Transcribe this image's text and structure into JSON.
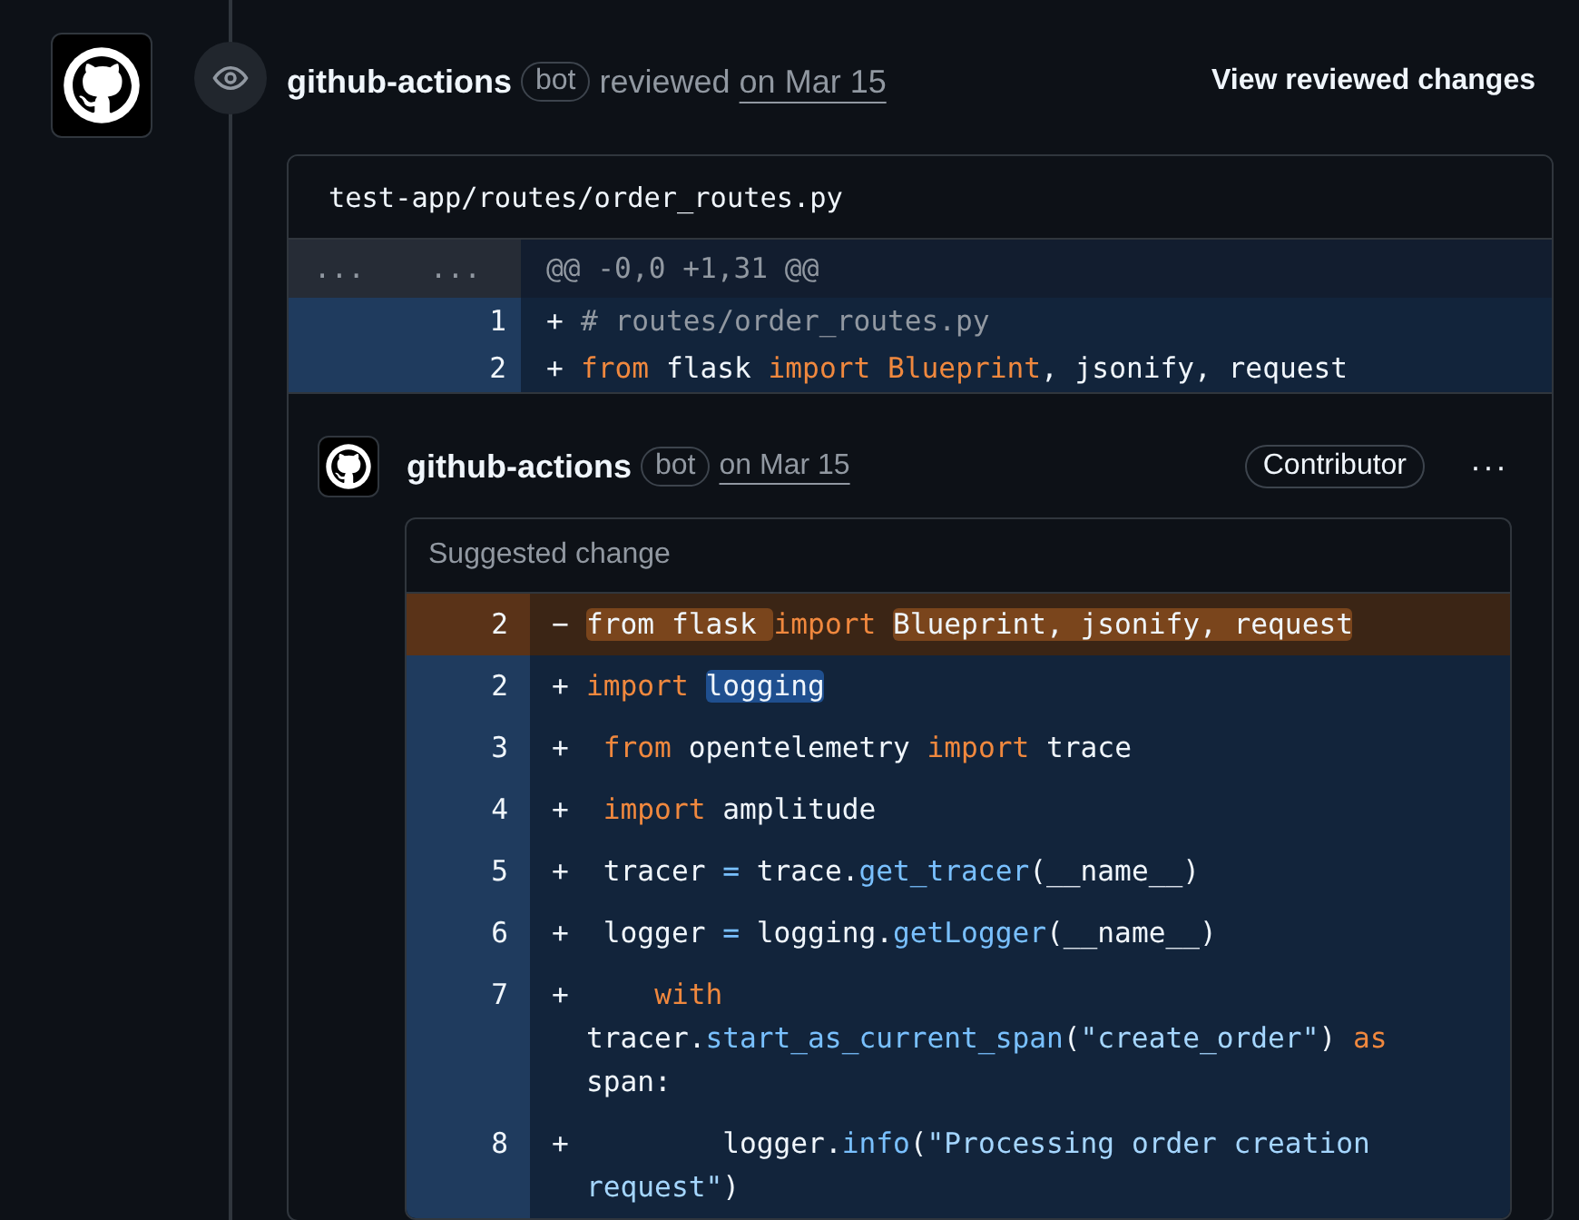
{
  "review": {
    "author": "github-actions",
    "badge": "bot",
    "action": "reviewed",
    "date": "on Mar 15",
    "link": "View reviewed changes"
  },
  "diff": {
    "file": "test-app/routes/order_routes.py",
    "hunk": {
      "old": "...",
      "new": "...",
      "header": "@@ -0,0 +1,31 @@"
    },
    "lines": [
      {
        "kind": "add",
        "new": "1",
        "sign": "+",
        "tokens": [
          {
            "t": "# routes/order_routes.py",
            "kind": "comment"
          }
        ]
      },
      {
        "kind": "add",
        "new": "2",
        "sign": "+",
        "tokens": [
          {
            "t": "from",
            "kind": "keyword"
          },
          {
            "t": " flask ",
            "kind": "text"
          },
          {
            "t": "import",
            "kind": "keyword"
          },
          {
            "t": " Blueprint",
            "kind": "keyword"
          },
          {
            "t": ", jsonify, request",
            "kind": "text"
          }
        ]
      }
    ]
  },
  "comment": {
    "author": "github-actions",
    "badge": "bot",
    "date": "on Mar 15",
    "role": "Contributor",
    "menu": "···",
    "suggestion": {
      "title": "Suggested change",
      "lines": [
        {
          "kind": "del",
          "num": "2",
          "sign": "−",
          "tokens": [
            {
              "t": "from flask ",
              "kind": "text",
              "marked": true
            },
            {
              "t": "import ",
              "kind": "keyword",
              "marked": false
            },
            {
              "t": "Blueprint, jsonify, request",
              "kind": "text",
              "marked": true
            }
          ]
        },
        {
          "kind": "add",
          "num": "2",
          "sign": "+",
          "tokens": [
            {
              "t": "import ",
              "kind": "keyword",
              "marked": false
            },
            {
              "t": "logging",
              "kind": "text",
              "marked": true
            }
          ]
        },
        {
          "kind": "add",
          "num": "3",
          "sign": "+",
          "tokens": [
            {
              "t": " from",
              "kind": "keyword",
              "marked": false
            },
            {
              "t": " opentelemetry ",
              "kind": "text",
              "marked": false
            },
            {
              "t": "import",
              "kind": "keyword",
              "marked": false
            },
            {
              "t": " trace",
              "kind": "text",
              "marked": false
            }
          ]
        },
        {
          "kind": "add",
          "num": "4",
          "sign": "+",
          "tokens": [
            {
              "t": " import",
              "kind": "keyword",
              "marked": false
            },
            {
              "t": " amplitude",
              "kind": "text",
              "marked": false
            }
          ]
        },
        {
          "kind": "add",
          "num": "5",
          "sign": "+",
          "tokens": [
            {
              "t": " tracer ",
              "kind": "text",
              "marked": false
            },
            {
              "t": "=",
              "kind": "operator",
              "marked": false
            },
            {
              "t": " trace.",
              "kind": "text",
              "marked": false
            },
            {
              "t": "get_tracer",
              "kind": "function",
              "marked": false
            },
            {
              "t": "(__name__)",
              "kind": "text",
              "marked": false
            }
          ]
        },
        {
          "kind": "add",
          "num": "6",
          "sign": "+",
          "tokens": [
            {
              "t": " logger ",
              "kind": "text",
              "marked": false
            },
            {
              "t": "=",
              "kind": "operator",
              "marked": false
            },
            {
              "t": " logging.",
              "kind": "text",
              "marked": false
            },
            {
              "t": "getLogger",
              "kind": "function",
              "marked": false
            },
            {
              "t": "(__name__)",
              "kind": "text",
              "marked": false
            }
          ]
        },
        {
          "kind": "add",
          "num": "7",
          "sign": "+",
          "tokens": [
            {
              "t": "    with",
              "kind": "keyword",
              "marked": false
            },
            {
              "t": " tracer.",
              "kind": "text",
              "marked": false
            },
            {
              "t": "start_as_current_span",
              "kind": "function",
              "marked": false
            },
            {
              "t": "(",
              "kind": "text",
              "marked": false
            },
            {
              "t": "\"create_order\"",
              "kind": "string",
              "marked": false
            },
            {
              "t": ") ",
              "kind": "text",
              "marked": false
            },
            {
              "t": "as",
              "kind": "keyword",
              "marked": false
            },
            {
              "t": " span:",
              "kind": "text",
              "marked": false
            }
          ]
        },
        {
          "kind": "add",
          "num": "8",
          "sign": "+",
          "tokens": [
            {
              "t": "        logger.",
              "kind": "text",
              "marked": false
            },
            {
              "t": "info",
              "kind": "function",
              "marked": false
            },
            {
              "t": "(",
              "kind": "text",
              "marked": false
            },
            {
              "t": "\"Processing order creation request\"",
              "kind": "string",
              "marked": false
            },
            {
              "t": ")",
              "kind": "text",
              "marked": false
            }
          ]
        }
      ]
    }
  }
}
